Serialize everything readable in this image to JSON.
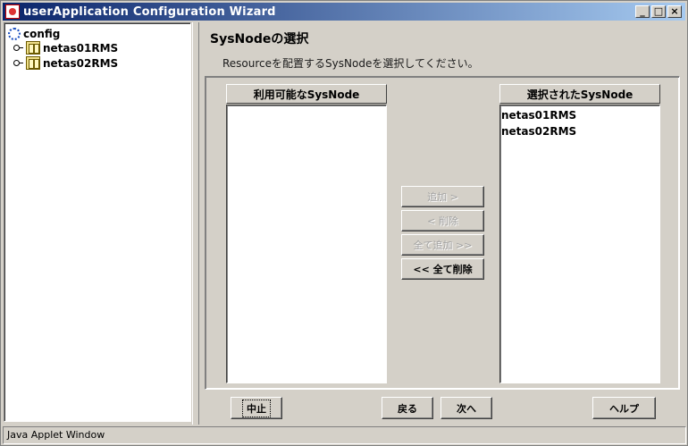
{
  "window": {
    "title": "userApplication Configuration Wizard",
    "controls": {
      "minimize": "_",
      "maximize": "□",
      "close": "×"
    }
  },
  "tree": {
    "root_label": "config",
    "nodes": [
      {
        "label": "netas01RMS",
        "icon": "server-icon"
      },
      {
        "label": "netas02RMS",
        "icon": "server-icon"
      }
    ]
  },
  "main": {
    "section_title": "SysNodeの選択",
    "instruction": "Resourceを配置するSysNodeを選択してください。",
    "available_header": "利用可能なSysNode",
    "available_items": [],
    "selected_header": "選択されたSysNode",
    "selected_items": [
      "netas01RMS",
      "netas02RMS"
    ],
    "buttons": {
      "add": "追加 >",
      "remove": "< 削除",
      "add_all": "全て追加 >>",
      "remove_all": "<< 全て削除"
    }
  },
  "footer": {
    "cancel": "中止",
    "back": "戻る",
    "next": "次へ",
    "help": "ヘルプ"
  },
  "status": {
    "text": "Java Applet Window"
  },
  "colors": {
    "titlebar_start": "#0a246a",
    "titlebar_end": "#a6caf0",
    "face": "#d4d0c8",
    "disabled_text": "#a0a0a0"
  }
}
